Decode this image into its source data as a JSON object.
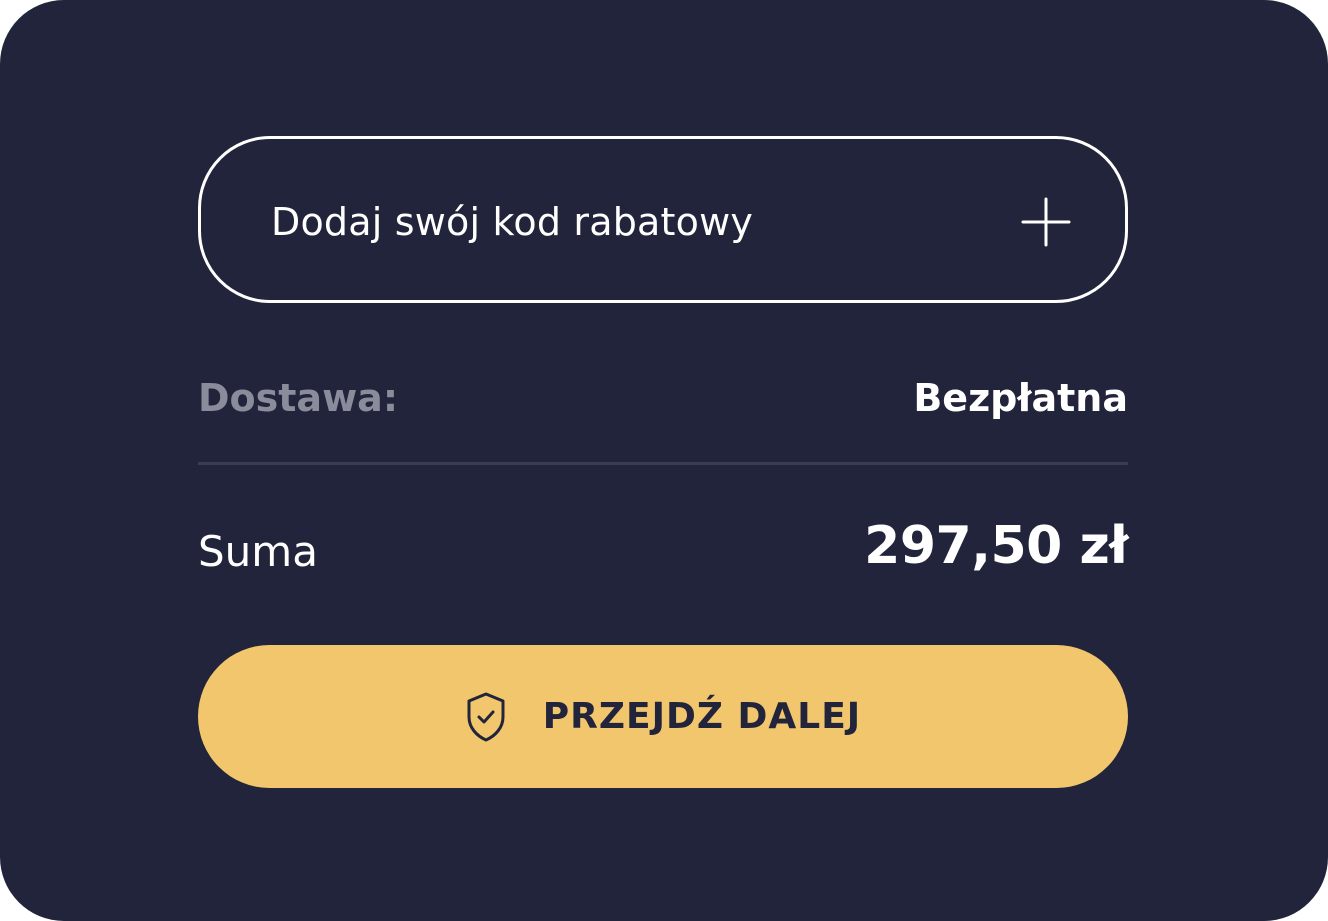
{
  "discount": {
    "label": "Dodaj swój kod rabatowy",
    "icon": "plus-icon"
  },
  "delivery": {
    "label": "Dostawa:",
    "value": "Bezpłatna"
  },
  "total": {
    "label": "Suma",
    "value": "297,50 zł"
  },
  "cta": {
    "label": "PRZEJDŹ DALEJ",
    "icon": "shield-check-icon"
  },
  "colors": {
    "background": "#22243b",
    "accent": "#f2c66d",
    "muted_text": "#8a8c9c",
    "divider": "#3a3c52",
    "text": "#ffffff"
  }
}
